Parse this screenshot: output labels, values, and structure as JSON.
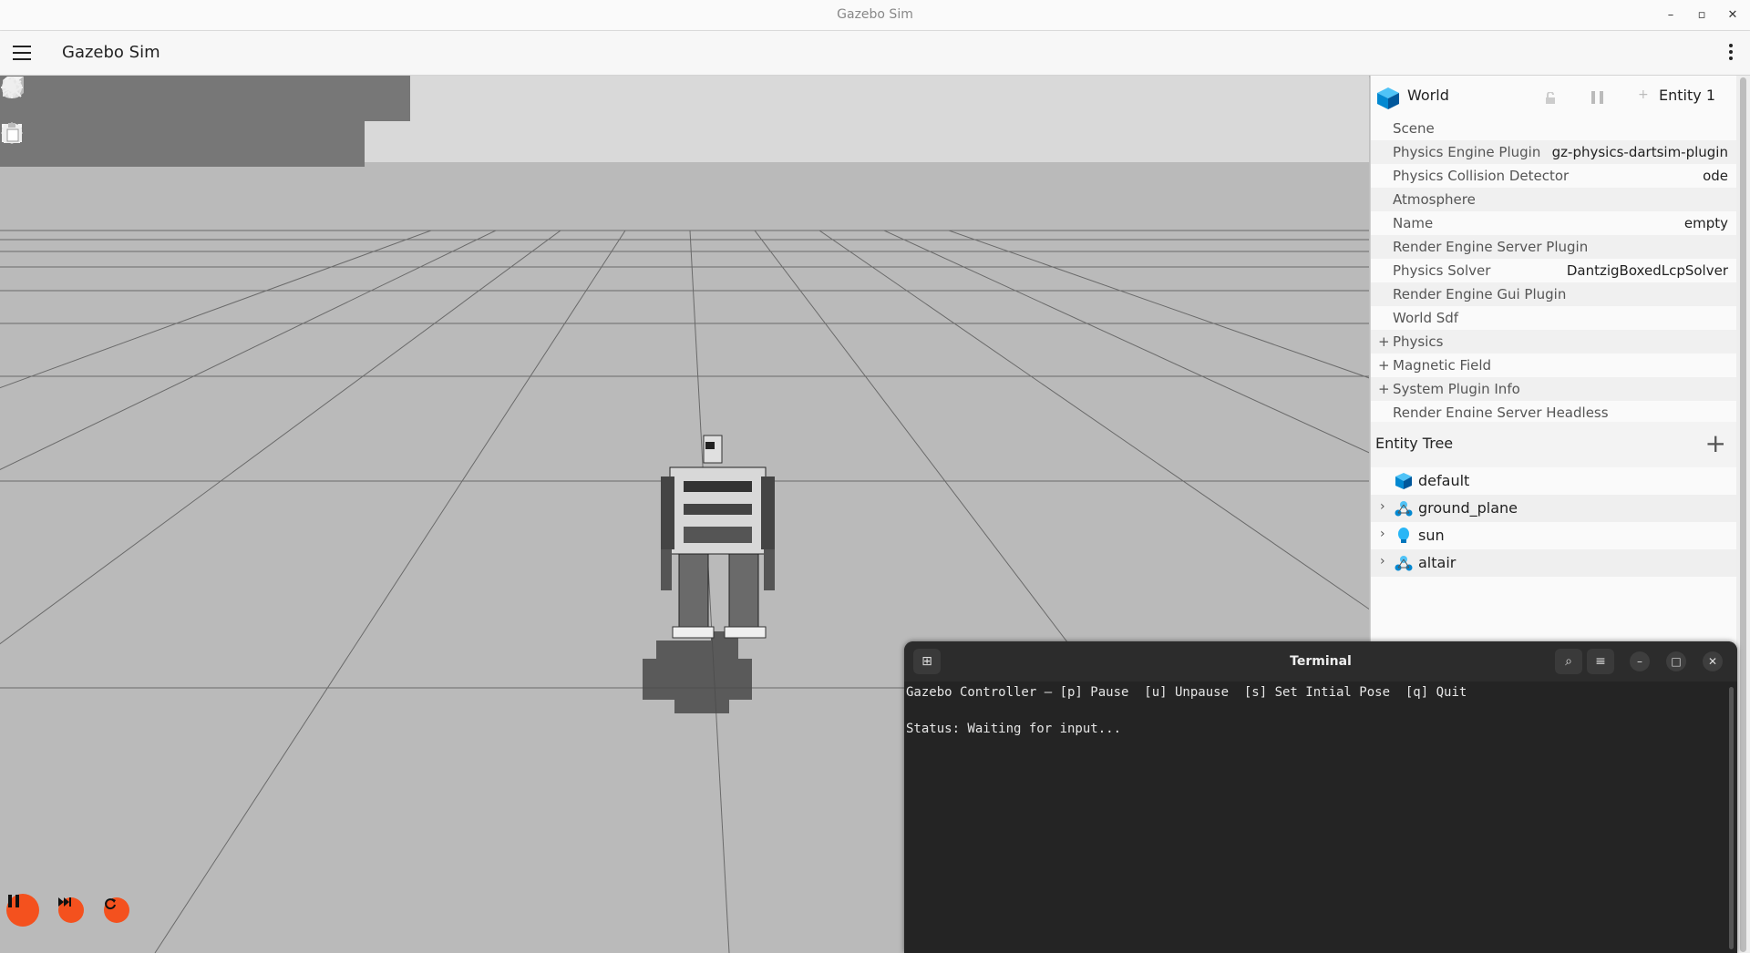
{
  "window": {
    "title": "Gazebo Sim"
  },
  "appbar": {
    "title": "Gazebo Sim"
  },
  "toolbar": {
    "shapes": [
      "box-icon",
      "sphere-icon",
      "cone-icon",
      "cylinder-icon",
      "capsule-icon",
      "ellipsoid-icon",
      "point-light-icon",
      "directional-light-icon",
      "spot-light-icon"
    ],
    "tools": [
      "select-icon",
      "translate-icon",
      "rotate-icon",
      "transform-control-icon",
      "grid-icon",
      "screenshot-icon",
      "copy-icon",
      "paste-icon"
    ]
  },
  "component_inspector": {
    "entity_name": "World",
    "entity_id": "Entity 1",
    "properties": [
      {
        "label": "Scene",
        "value": ""
      },
      {
        "label": "Physics Engine Plugin",
        "value": "gz-physics-dartsim-plugin"
      },
      {
        "label": "Physics Collision Detector",
        "value": "ode"
      },
      {
        "label": "Atmosphere",
        "value": ""
      },
      {
        "label": "Name",
        "value": "empty"
      },
      {
        "label": "Render Engine Server Plugin",
        "value": ""
      },
      {
        "label": "Physics Solver",
        "value": "DantzigBoxedLcpSolver"
      },
      {
        "label": "Render Engine Gui Plugin",
        "value": ""
      },
      {
        "label": "World Sdf",
        "value": ""
      },
      {
        "label": "Physics",
        "value": "",
        "expandable": true
      },
      {
        "label": "Magnetic Field",
        "value": "",
        "expandable": true
      },
      {
        "label": "System Plugin Info",
        "value": "",
        "expandable": true
      },
      {
        "label": "Render Engine Server Headless",
        "value": ""
      }
    ]
  },
  "entity_tree": {
    "title": "Entity Tree",
    "items": [
      {
        "name": "default",
        "icon": "world-cube-icon",
        "expandable": false
      },
      {
        "name": "ground_plane",
        "icon": "model-icon",
        "expandable": true
      },
      {
        "name": "sun",
        "icon": "light-bulb-icon",
        "expandable": true
      },
      {
        "name": "altair",
        "icon": "model-icon",
        "expandable": true
      }
    ]
  },
  "terminal": {
    "title": "Terminal",
    "lines": [
      "Gazebo Controller – [p] Pause  [u] Unpause  [s] Set Intial Pose  [q] Quit",
      "",
      "Status: Waiting for input..."
    ]
  },
  "playback": {
    "buttons": [
      "pause-icon",
      "step-icon",
      "reset-icon"
    ]
  },
  "colors": {
    "accent": "#f4511e",
    "world_icon": "#1ba1e2",
    "toolbar_bg": "#777777"
  }
}
